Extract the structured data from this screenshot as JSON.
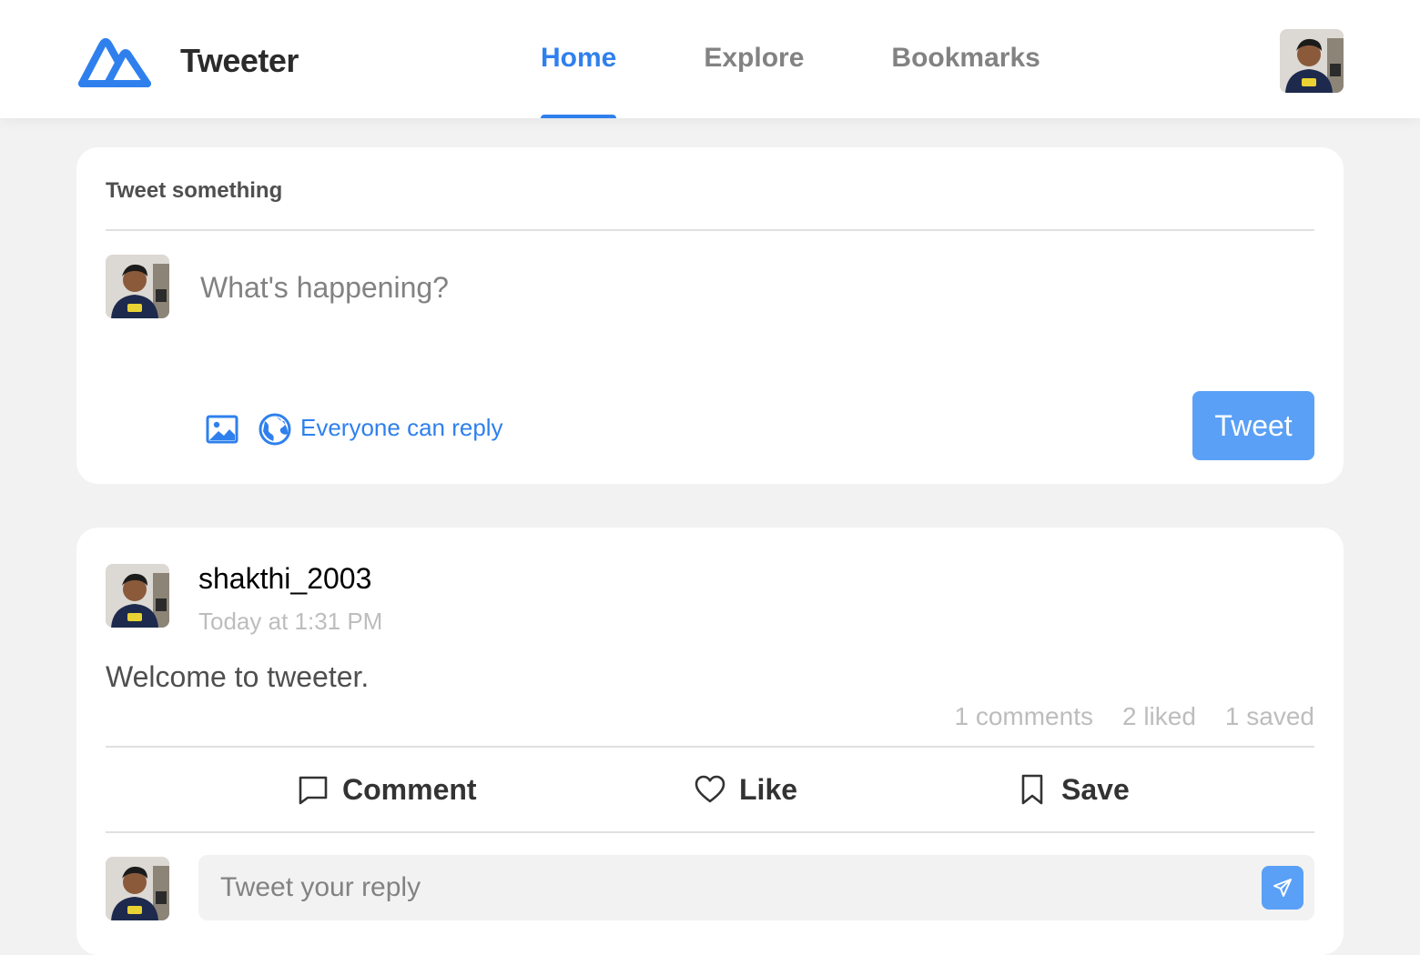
{
  "app": {
    "brand": "Tweeter",
    "accent_color": "#2f80ed"
  },
  "nav": {
    "items": [
      {
        "label": "Home",
        "active": true
      },
      {
        "label": "Explore",
        "active": false
      },
      {
        "label": "Bookmarks",
        "active": false
      }
    ]
  },
  "compose": {
    "title": "Tweet something",
    "placeholder": "What's happening?",
    "image_icon": "image-icon",
    "globe_icon": "globe-icon",
    "reply_setting": "Everyone can reply",
    "submit_label": "Tweet"
  },
  "post": {
    "author": "shakthi_2003",
    "time": "Today at 1:31 PM",
    "text": "Welcome to tweeter.",
    "stats": {
      "comments": "1 comments",
      "liked": "2 liked",
      "saved": "1 saved"
    },
    "actions": {
      "comment": "Comment",
      "like": "Like",
      "save": "Save"
    },
    "reply_placeholder": "Tweet your reply"
  }
}
